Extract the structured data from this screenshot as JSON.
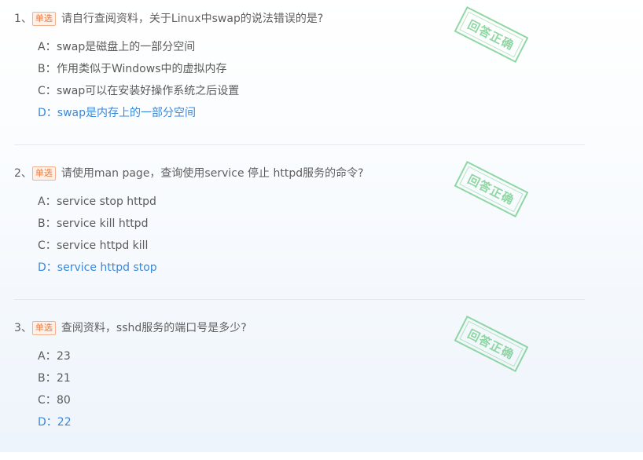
{
  "quiz": {
    "questions": [
      {
        "number": "1、",
        "type": "单选",
        "title": "请自行查阅资料，关于Linux中swap的说法错误的是?",
        "stamp": "回答正确",
        "options": [
          {
            "label": "A：",
            "text": "swap是磁盘上的一部分空间",
            "correct": false
          },
          {
            "label": "B：",
            "text": "作用类似于Windows中的虚拟内存",
            "correct": false
          },
          {
            "label": "C：",
            "text": "swap可以在安装好操作系统之后设置",
            "correct": false
          },
          {
            "label": "D：",
            "text": "swap是内存上的一部分空间",
            "correct": true
          }
        ]
      },
      {
        "number": "2、",
        "type": "单选",
        "title": "请使用man page，查询使用service 停止 httpd服务的命令?",
        "stamp": "回答正确",
        "options": [
          {
            "label": "A：",
            "text": "service stop httpd",
            "correct": false
          },
          {
            "label": "B：",
            "text": "service kill httpd",
            "correct": false
          },
          {
            "label": "C：",
            "text": "service httpd kill",
            "correct": false
          },
          {
            "label": "D：",
            "text": "service httpd stop",
            "correct": true
          }
        ]
      },
      {
        "number": "3、",
        "type": "单选",
        "title": "查阅资料，sshd服务的端口号是多少?",
        "stamp": "回答正确",
        "options": [
          {
            "label": "A：",
            "text": "23",
            "correct": false
          },
          {
            "label": "B：",
            "text": "21",
            "correct": false
          },
          {
            "label": "C：",
            "text": "80",
            "correct": false
          },
          {
            "label": "D：",
            "text": "22",
            "correct": true
          }
        ]
      }
    ]
  },
  "colors": {
    "correct_text": "#3b87d8",
    "stamp": "#67c980",
    "type_badge": "#e9773a"
  }
}
